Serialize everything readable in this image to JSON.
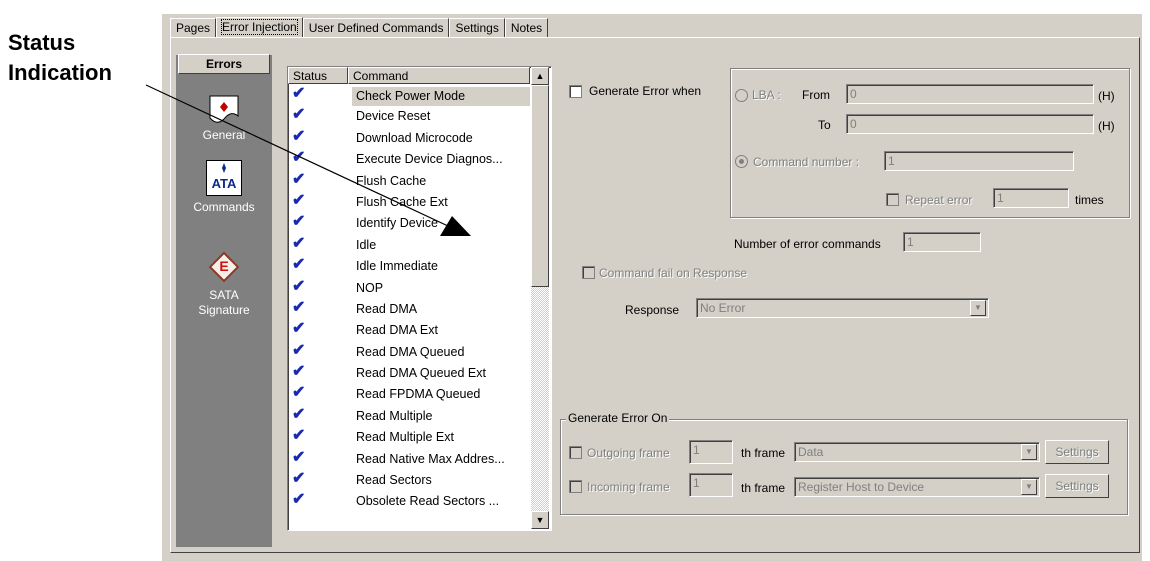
{
  "callout": {
    "line1": "Status",
    "line2": "Indication"
  },
  "tabs": [
    "Pages",
    "Error Injection",
    "User Defined Commands",
    "Settings",
    "Notes"
  ],
  "sidebar": {
    "header": "Errors",
    "items": [
      {
        "label": "General",
        "icon": "general-icon"
      },
      {
        "label": "Commands",
        "icon": "ata-icon",
        "badge": "ATA"
      },
      {
        "label": "SATA Signature",
        "icon": "sata-signature-icon",
        "badge": "E"
      }
    ]
  },
  "list": {
    "columns": [
      "Status",
      "Command"
    ],
    "rows": [
      "Check Power Mode",
      "Device Reset",
      "Download Microcode",
      "Execute Device Diagnos...",
      "Flush Cache",
      "Flush Cache Ext",
      "Identify Device",
      "Idle",
      "Idle Immediate",
      "NOP",
      "Read DMA",
      "Read DMA Ext",
      "Read DMA Queued",
      "Read DMA Queued Ext",
      "Read FPDMA Queued",
      "Read Multiple",
      "Read Multiple Ext",
      "Read Native Max Addres...",
      "Read Sectors",
      "Obsolete Read Sectors ..."
    ],
    "check_glyph": "✔"
  },
  "error": {
    "generate_label": "Generate Error when",
    "lba_label": "LBA :",
    "from_label": "From",
    "from_value": "0",
    "to_label": "To",
    "to_value": "0",
    "hex_unit": "(H)",
    "command_number_label": "Command number :",
    "command_number_value": "1",
    "repeat_label": "Repeat error",
    "repeat_value": "1",
    "times_label": "times",
    "num_error_label": "Number of error commands",
    "num_error_value": "1",
    "fail_response_label": "Command fail on Response",
    "response_label": "Response",
    "response_value": "No Error"
  },
  "generate_on": {
    "title": "Generate Error On",
    "outgoing_label": "Outgoing frame",
    "outgoing_value": "1",
    "incoming_label": "Incoming frame",
    "incoming_value": "1",
    "th_frame_label": "th frame",
    "outgoing_type": "Data",
    "incoming_type": "Register Host to Device",
    "settings_label": "Settings"
  }
}
